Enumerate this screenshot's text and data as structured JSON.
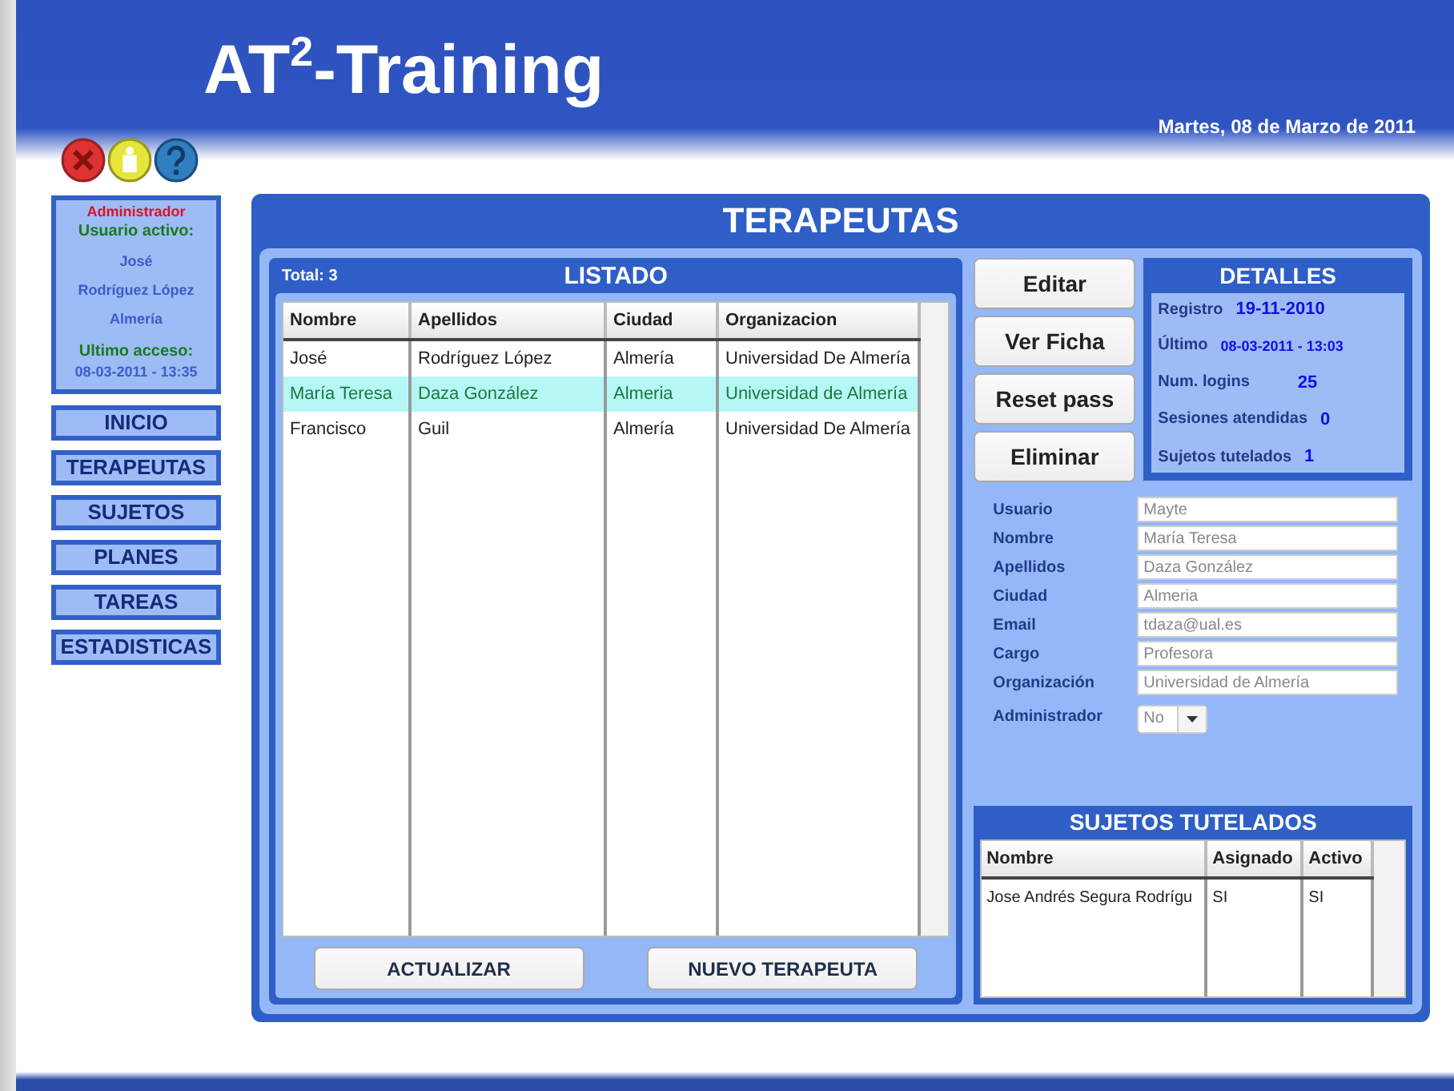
{
  "app": {
    "title": "AT$^{2}$-Training",
    "date": "Martes, 08 de Marzo de 2011"
  },
  "user_card": {
    "role": "Administrador",
    "active_label": "Usuario activo:",
    "first_name": "José",
    "last_name": "Rodríguez López",
    "city": "Almería",
    "last_access_label": "Ultimo acceso:",
    "last_access": "08-03-2011 - 13:35"
  },
  "nav": [
    {
      "label": "INICIO"
    },
    {
      "label": "TERAPEUTAS"
    },
    {
      "label": "SUJETOS"
    },
    {
      "label": "PLANES"
    },
    {
      "label": "TAREAS"
    },
    {
      "label": "ESTADISTICAS"
    }
  ],
  "panel_title": "TERAPEUTAS",
  "listado": {
    "total": "Total: 3",
    "title": "LISTADO",
    "columns": [
      "Nombre",
      "Apellidos",
      "Ciudad",
      "Organizacion"
    ],
    "rows": [
      {
        "cells": [
          "José",
          "Rodríguez López",
          "Almería",
          "Universidad De Almería"
        ],
        "selected": false
      },
      {
        "cells": [
          "María Teresa",
          "Daza González",
          "Almeria",
          "Universidad de Almería"
        ],
        "selected": true
      },
      {
        "cells": [
          "Francisco",
          "Guil",
          "Almería",
          "Universidad De Almería"
        ],
        "selected": false
      }
    ],
    "buttons": [
      "ACTUALIZAR",
      "NUEVO TERAPEUTA"
    ]
  },
  "actions": [
    "Editar",
    "Ver Ficha",
    "Reset pass",
    "Eliminar"
  ],
  "details": {
    "title": "DETALLES",
    "items": [
      {
        "label": "Registro",
        "value": "19-11-2010"
      },
      {
        "label": "Último",
        "value": "08-03-2011 - 13:03"
      },
      {
        "label": "Num. logins",
        "value": "25"
      },
      {
        "label": "Sesiones atendidas",
        "value": "0"
      },
      {
        "label": "Sujetos tutelados",
        "value": "1"
      }
    ]
  },
  "form": [
    {
      "label": "Usuario",
      "value": "Mayte"
    },
    {
      "label": "Nombre",
      "value": "María Teresa"
    },
    {
      "label": "Apellidos",
      "value": "Daza González"
    },
    {
      "label": "Ciudad",
      "value": "Almeria"
    },
    {
      "label": "Email",
      "value": "tdaza@ual.es"
    },
    {
      "label": "Cargo",
      "value": "Profesora"
    },
    {
      "label": "Organización",
      "value": "Universidad de Almería"
    }
  ],
  "administrador": {
    "label": "Administrador",
    "value": "No"
  },
  "tutelados": {
    "title": "SUJETOS TUTELADOS",
    "columns": [
      "Nombre",
      "Asignado",
      "Activo"
    ],
    "rows": [
      [
        "Jose Andrés Segura Rodrígu",
        "SI",
        "SI"
      ]
    ]
  }
}
